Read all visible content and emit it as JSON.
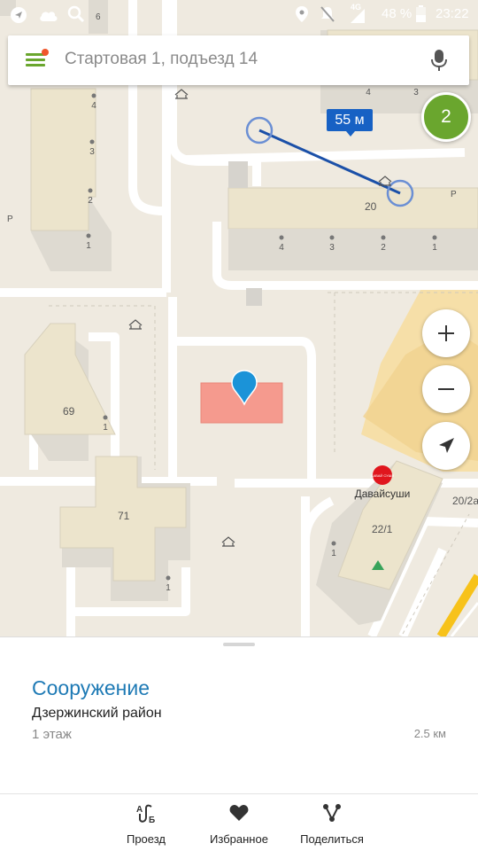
{
  "status": {
    "network": "4G",
    "battery": "48 %",
    "time": "23:22"
  },
  "search": {
    "placeholder": "Стартовая 1, подъезд 14"
  },
  "map": {
    "pin_count": "2",
    "distance_label": "55 м",
    "building_labels": {
      "b20": "20",
      "b69": "69",
      "b71": "71",
      "b22_1": "22/1",
      "b20_2": "20/2а",
      "parking1": "P",
      "parking2": "P",
      "parking3": "P"
    },
    "entrance_numbers": {
      "top_row": [
        "4",
        "3"
      ],
      "left_tower": [
        "4",
        "3",
        "2",
        "1"
      ],
      "b20": [
        "4",
        "3",
        "2",
        "1"
      ],
      "b69": [
        "1"
      ],
      "b71": [
        "1"
      ],
      "b22_1": [
        "1"
      ],
      "edge6": "6"
    },
    "poi": {
      "name": "Давайсуши",
      "logo": "ДАВАЙ СУШИ"
    },
    "accent": "#1761c4"
  },
  "card": {
    "title": "Сооружение",
    "district": "Дзержинский район",
    "floors": "1 этаж",
    "distance": "2.5 км"
  },
  "actions": [
    {
      "label": "Проезд",
      "icon": "route-icon"
    },
    {
      "label": "Избранное",
      "icon": "heart-icon"
    },
    {
      "label": "Поделиться",
      "icon": "share-icon"
    }
  ]
}
